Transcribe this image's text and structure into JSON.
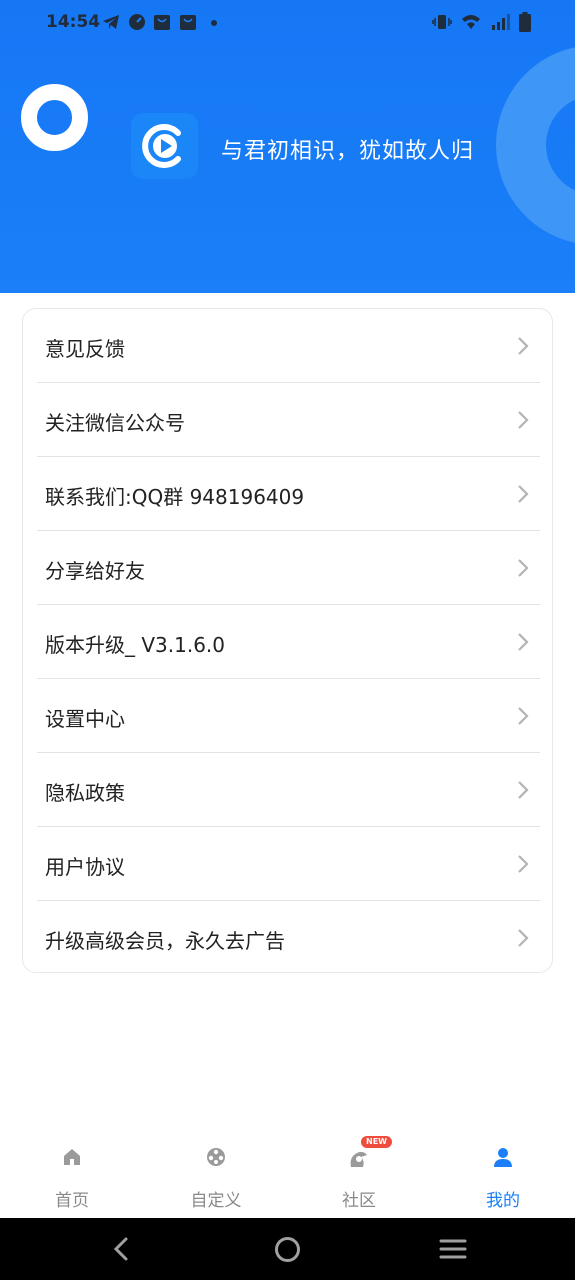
{
  "status_bar": {
    "time": "14:54"
  },
  "header": {
    "slogan": "与君初相识，犹如故人归",
    "logo_icon": "play-circle-icon"
  },
  "menu": {
    "items": [
      {
        "label": "意见反馈"
      },
      {
        "label": "关注微信公众号"
      },
      {
        "label": "联系我们:QQ群 948196409"
      },
      {
        "label": "分享给好友"
      },
      {
        "label": "版本升级_ V3.1.6.0"
      },
      {
        "label": "设置中心"
      },
      {
        "label": "隐私政策"
      },
      {
        "label": "用户协议"
      },
      {
        "label": "升级高级会员，永久去广告"
      }
    ]
  },
  "bottom_nav": {
    "items": [
      {
        "label": "首页",
        "icon": "home-icon"
      },
      {
        "label": "自定义",
        "icon": "film-reel-icon"
      },
      {
        "label": "社区",
        "icon": "community-icon",
        "badge": "NEW"
      },
      {
        "label": "我的",
        "icon": "user-icon",
        "active": true
      }
    ]
  },
  "colors": {
    "primary": "#1a7ff8",
    "header_ring": "#3e97f7",
    "badge": "#f04c3e",
    "inactive_text": "#8a8a8a"
  }
}
